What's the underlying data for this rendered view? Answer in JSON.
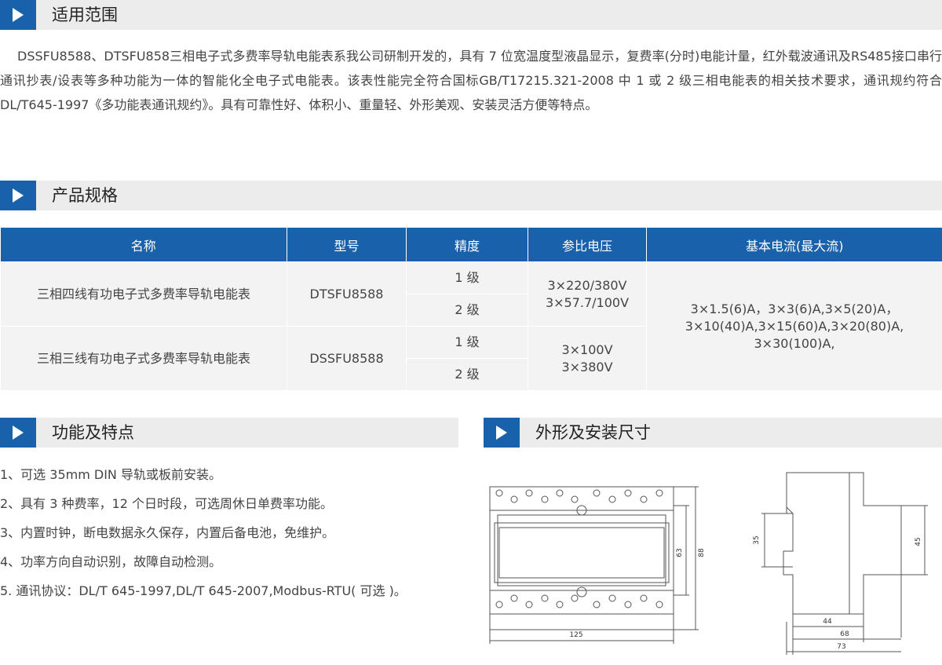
{
  "sections": {
    "scope": "适用范围",
    "spec": "产品规格",
    "features": "功能及特点",
    "dims": "外形及安装尺寸"
  },
  "intro": "DSSFU8588、DTSFU858三相电子式多费率导轨电能表系我公司研制开发的，具有 7 位宽温度型液晶显示，复费率(分时)电能计量，红外载波通讯及RS485接口串行通讯抄表/设表等多种功能为一体的智能化全电子式电能表。该表性能完全符合国标GB/T17215.321-2008 中 1 或 2 级三相电能表的相关技术要求，通讯规约符合 DL/T645-1997《多功能表通讯规约》。具有可靠性好、体积小、重量轻、外形美观、安装灵活方便等特点。",
  "table": {
    "headers": [
      "名称",
      "型号",
      "精度",
      "参比电压",
      "基本电流(最大流)"
    ],
    "rows": [
      {
        "name": "三相四线有功电子式多费率导轨电能表",
        "model": "DTSFU8588",
        "acc1": "1 级",
        "acc2": "2 级",
        "volt1": "3×220/380V",
        "volt2": "3×57.7/100V"
      },
      {
        "name": "三相三线有功电子式多费率导轨电能表",
        "model": "DSSFU8588",
        "acc1": "1 级",
        "acc2": "2 级",
        "volt1": "3×100V",
        "volt2": "3×380V"
      }
    ],
    "current": [
      "3×1.5(6)A，3×3(6)A,3×5(20)A，",
      "3×10(40)A,3×15(60)A,3×20(80)A,",
      "3×30(100)A,"
    ]
  },
  "features": [
    "1、可选 35mm DIN 导轨或板前安装。",
    "2、具有 3 种费率，12 个日时段，可选周休日单费率功能。",
    "3、内置时钟，断电数据永久保存，内置后备电池，免维护。",
    "4、功率方向自动识别，故障自动检测。",
    "5. 通讯协议：DL/T 645-1997,DL/T 645-2007,Modbus-RTU( 可选 )。"
  ],
  "dimensions": {
    "front_width": "125",
    "front_h1": "63",
    "front_h2": "88",
    "side_h1": "35",
    "side_h2": "45",
    "side_w1": "44",
    "side_w2": "68",
    "side_w3": "73"
  },
  "colors": {
    "accent": "#1a61ab",
    "section_bg": "#ececec",
    "cell_bg": "#f3f3f3"
  }
}
